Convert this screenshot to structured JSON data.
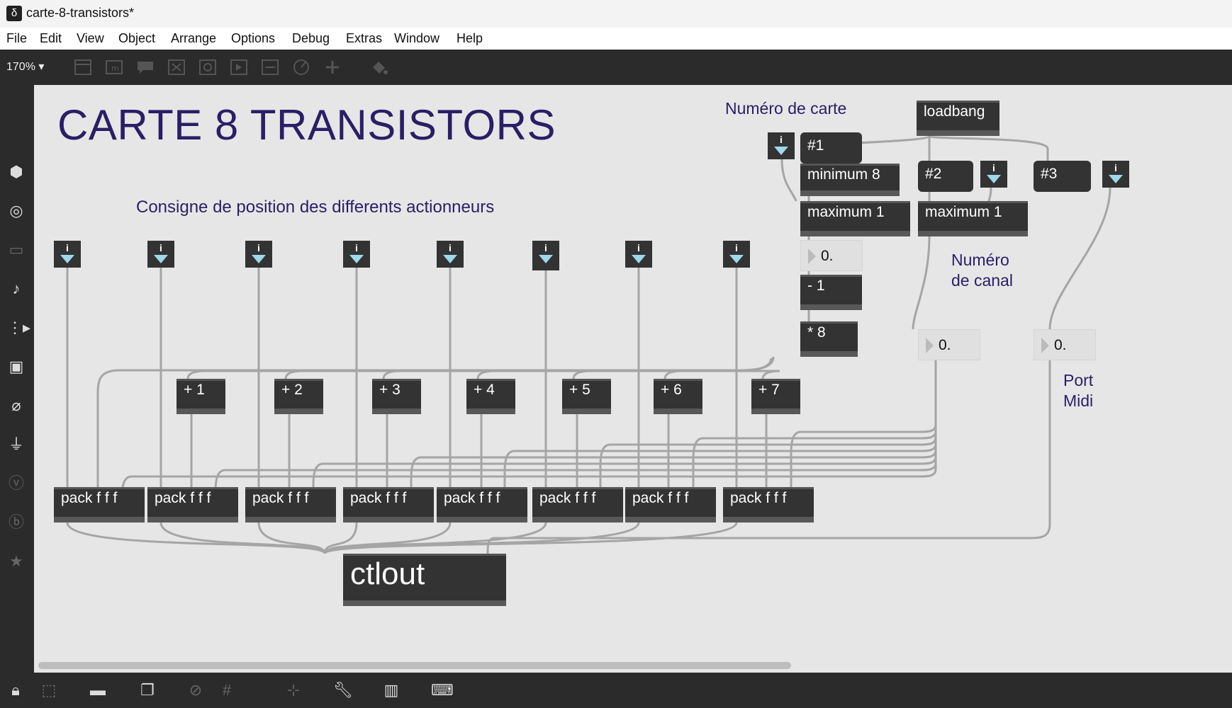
{
  "window": {
    "title": "carte-8-transistors*",
    "app_icon": "max-app-icon"
  },
  "menu": [
    "File",
    "Edit",
    "View",
    "Object",
    "Arrange",
    "Options",
    "Debug",
    "Extras",
    "Window",
    "Help"
  ],
  "toolbar": {
    "zoom": "170%",
    "icons": [
      "presentation-icon",
      "message-icon",
      "comment-icon",
      "button-icon",
      "toggle-icon",
      "number-icon",
      "slider-icon",
      "dial-icon",
      "add-object-icon",
      "paint-bucket-icon"
    ]
  },
  "sidebar_icons": [
    "cube-icon",
    "circle-target-icon",
    "film-icon",
    "music-note-icon",
    "playlist-icon",
    "image-icon",
    "paperclip-icon",
    "plugin-icon",
    "vimeo-icon",
    "bpatcher-icon",
    "star-icon"
  ],
  "bottom_icons": [
    "lock-icon",
    "presentation-toggle-icon",
    "comment-icon",
    "windows-icon",
    "hide-icon",
    "grid-icon",
    "snap-icon",
    "wrench-icon",
    "piano-icon",
    "keyboard-icon"
  ],
  "patch": {
    "title": "CARTE 8 TRANSISTORS",
    "subtitle": "Consigne de position des differents actionneurs",
    "comments": {
      "numero_carte": "Numéro de carte",
      "numero_canal_1": "Numéro",
      "numero_canal_2": "de canal",
      "port_1": "Port",
      "port_2": "Midi"
    },
    "int_label": "i",
    "objects": {
      "loadbang": "loadbang",
      "msg1": "#1",
      "msg2": "#2",
      "msg3": "#3",
      "minimum": "minimum 8",
      "maximum_a": "maximum 1",
      "maximum_b": "maximum 1",
      "minus": "- 1",
      "times": "* 8",
      "flonum": "0.",
      "adds": [
        "+ 1",
        "+ 2",
        "+ 3",
        "+ 4",
        "+ 5",
        "+ 6",
        "+ 7"
      ],
      "pack": "pack f f f",
      "ctlout": "ctlout"
    },
    "colors": {
      "title": "#2a1e66",
      "box": "#333333",
      "inlet_red": "#e89a9a",
      "inlet_blue": "#8fd0cf",
      "outlet_yellow": "#d6dc86"
    }
  }
}
